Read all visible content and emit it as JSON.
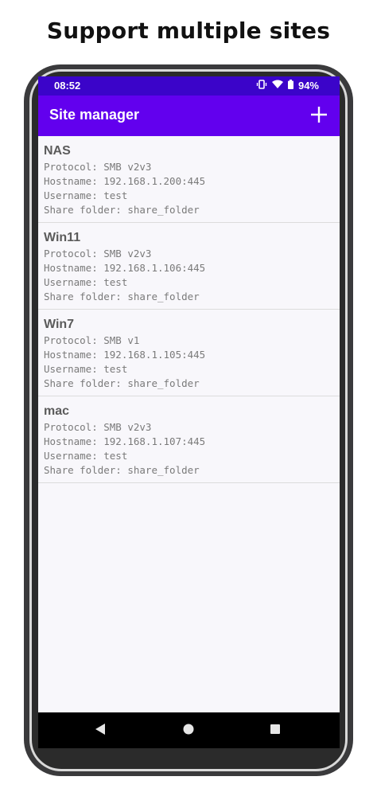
{
  "headline": "Support multiple sites",
  "status_bar": {
    "time": "08:52",
    "battery": "94%"
  },
  "app_bar": {
    "title": "Site manager",
    "add_icon": "plus-icon"
  },
  "sites": [
    {
      "name": "NAS",
      "protocol": "Protocol: SMB v2v3",
      "hostname": "Hostname: 192.168.1.200:445",
      "username": "Username: test",
      "share": "Share folder: share_folder"
    },
    {
      "name": "Win11",
      "protocol": "Protocol: SMB v2v3",
      "hostname": "Hostname: 192.168.1.106:445",
      "username": "Username: test",
      "share": "Share folder: share_folder"
    },
    {
      "name": "Win7",
      "protocol": "Protocol: SMB v1",
      "hostname": "Hostname: 192.168.1.105:445",
      "username": "Username: test",
      "share": "Share folder: share_folder"
    },
    {
      "name": "mac",
      "protocol": "Protocol: SMB v2v3",
      "hostname": "Hostname: 192.168.1.107:445",
      "username": "Username: test",
      "share": "Share folder: share_folder"
    }
  ],
  "nav_bar": {
    "back_icon": "back-triangle-icon",
    "home_icon": "home-circle-icon",
    "recents_icon": "recents-square-icon"
  },
  "colors": {
    "status_bar": "#3b04c9",
    "app_bar": "#6200ee",
    "background": "#f8f7fb"
  }
}
